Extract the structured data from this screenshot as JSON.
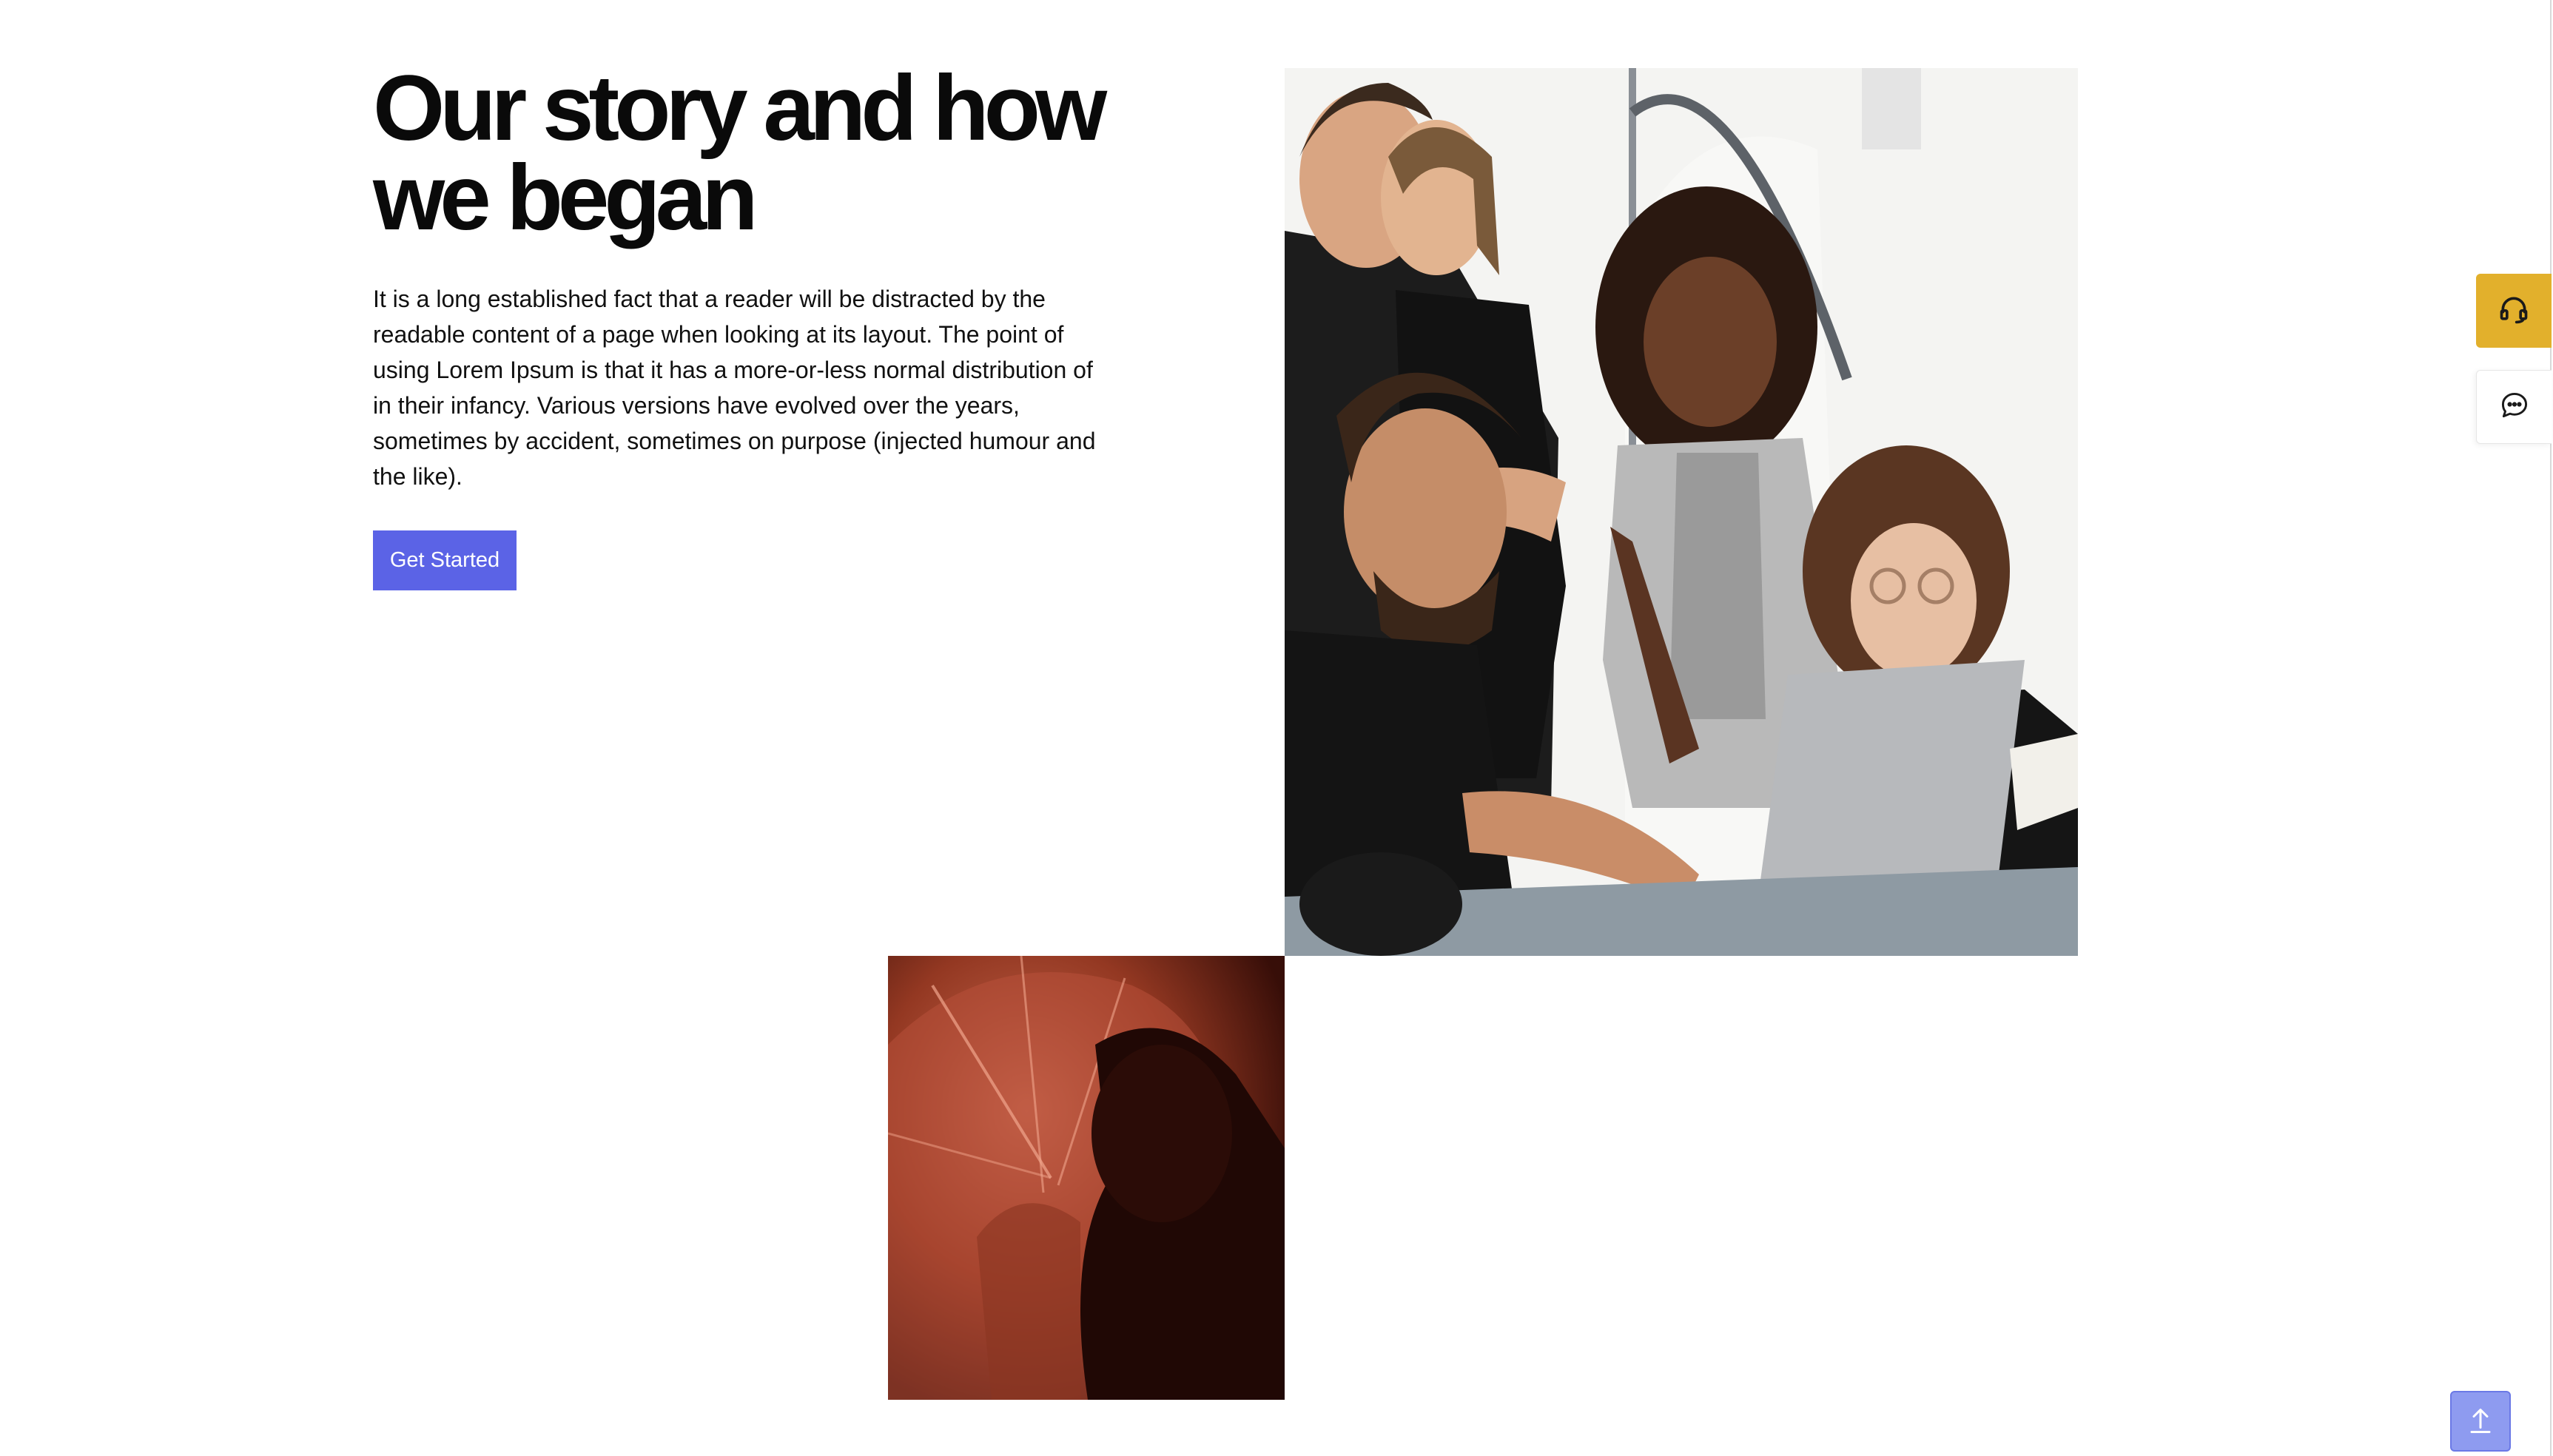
{
  "hero": {
    "title": "Our story and how we began",
    "description": "It is a long established fact that a reader will be distracted by the readable content of a page when looking at its layout. The point of using Lorem Ipsum is that it has a more-or-less normal distribution of in their infancy. Various versions have evolved over the years, sometimes by accident, sometimes on purpose (injected humour and the like).",
    "cta_label": "Get Started"
  },
  "colors": {
    "cta_background": "#5b63e6",
    "support_accent": "#e2b02c",
    "scroll_top": "#8e9bf0"
  },
  "side_buttons": [
    {
      "icon": "headset-icon"
    },
    {
      "icon": "chat-bubble-icon"
    }
  ],
  "scroll_top": {
    "icon": "arrow-up-icon"
  }
}
